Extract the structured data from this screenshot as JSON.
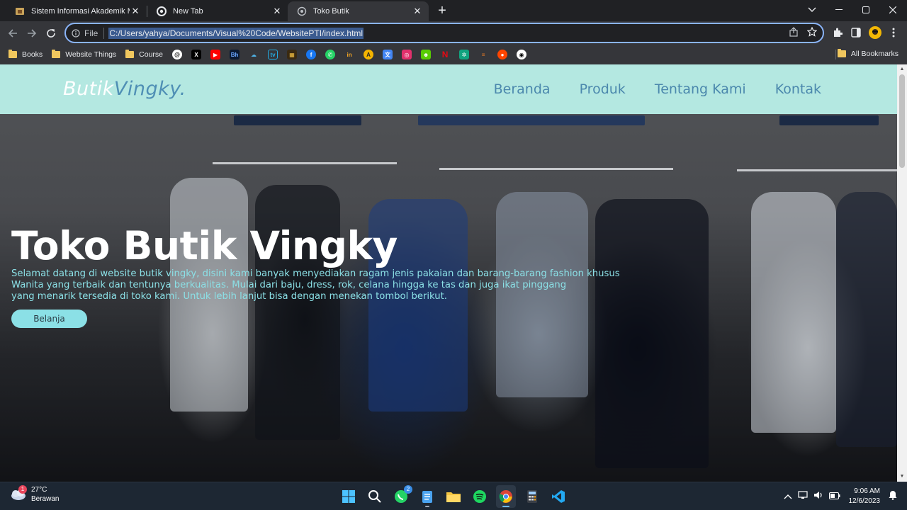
{
  "tabs": [
    {
      "title": "Sistem Informasi Akademik Mah",
      "active": false
    },
    {
      "title": "New Tab",
      "active": false
    },
    {
      "title": "Toko Butik",
      "active": true
    }
  ],
  "address_bar": {
    "scheme_label": "File",
    "url": "C:/Users/yahya/Documents/Visual%20Code/WebsitePTI/index.html"
  },
  "bookmarks": {
    "folders": [
      "Books",
      "Website Things",
      "Course"
    ],
    "icons": [
      "threads-icon",
      "x-icon",
      "youtube-icon",
      "bh-icon",
      "cloud-icon",
      "bilibili-icon",
      "app-icon",
      "facebook-icon",
      "whatsapp-icon",
      "linkedin-icon",
      "a-icon",
      "translate-icon",
      "instagram-icon",
      "duolingo-icon",
      "netflix-icon",
      "chatgpt-icon",
      "stack-icon",
      "reddit-icon",
      "github-icon"
    ],
    "all_label": "All Bookmarks"
  },
  "site": {
    "logo_part1": "Butik",
    "logo_part2": "Vingky.",
    "nav": [
      "Beranda",
      "Produk",
      "Tentang Kami",
      "Kontak"
    ],
    "hero_title": "Toko Butik Vingky",
    "hero_lines": [
      "Selamat datang di website butik vingky, disini kami banyak menyediakan ragam jenis pakaian dan barang-barang fashion khusus",
      "Wanita yang terbaik dan tentunya berkualitas. Mulai dari baju, dress, rok, celana hingga ke tas dan juga ikat pinggang",
      "yang menarik tersedia di toko kami. Untuk lebih lanjut bisa dengan menekan tombol berikut."
    ],
    "cta_label": "Belanja"
  },
  "taskbar": {
    "weather_temp": "27°C",
    "weather_desc": "Berawan",
    "weather_badge": "1",
    "whatsapp_badge": "2",
    "time": "9:06 AM",
    "date": "12/6/2023"
  },
  "colors": {
    "nav_bg": "#b4e8e1",
    "nav_link": "#4b88ad",
    "hero_text": "#8be0e6",
    "cta_bg": "#8be0e6"
  }
}
